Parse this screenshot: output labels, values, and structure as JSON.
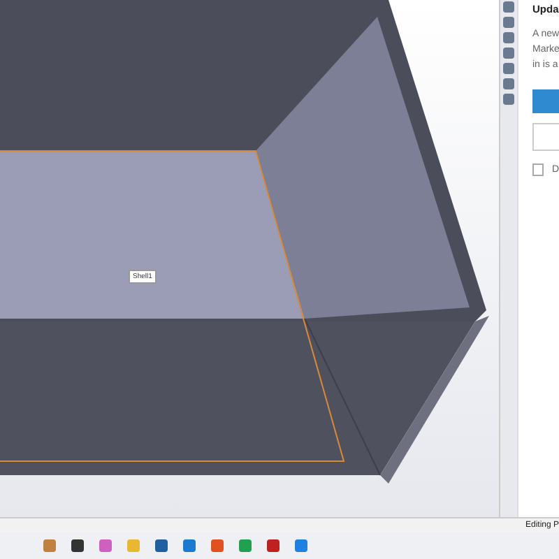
{
  "viewport": {
    "feature_label": "Shell1"
  },
  "task_pane": {
    "title": "Upda",
    "message_lines": [
      "A new",
      "Marke",
      "in is a"
    ],
    "checkbox": {
      "label": "D",
      "checked": false
    }
  },
  "status_bar": {
    "text": "Editing P"
  }
}
